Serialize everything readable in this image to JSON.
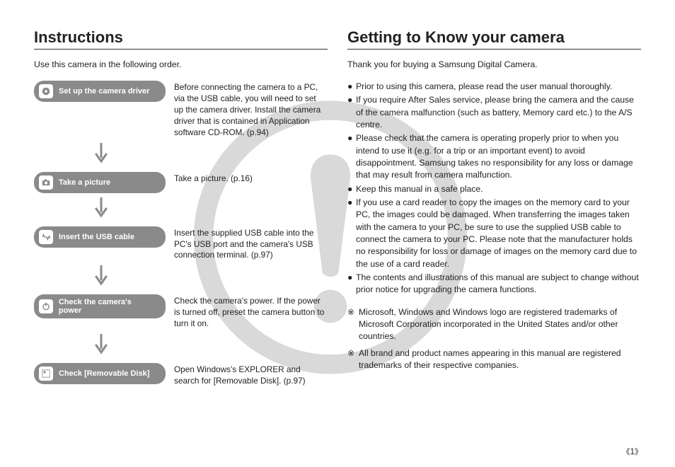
{
  "page_number": "1",
  "left": {
    "title": "Instructions",
    "subtitle": "Use this camera in the following order.",
    "steps": [
      {
        "label": "Set up the camera driver",
        "icon": "cd-icon",
        "text": "Before connecting the camera to a PC, via the USB cable, you will need to set up the camera driver. Install the camera driver that is contained in Application software CD-ROM. (p.94)"
      },
      {
        "label": "Take a picture",
        "icon": "camera-icon",
        "text": "Take a picture. (p.16)"
      },
      {
        "label": "Insert the USB cable",
        "icon": "usb-icon",
        "text": "Insert the supplied USB cable into the PC's USB port and the camera's USB connection terminal. (p.97)"
      },
      {
        "label": "Check the camera's power",
        "icon": "power-icon",
        "text": "Check the camera's power. If the power is turned off, preset the camera button to turn it on."
      },
      {
        "label": "Check [Removable Disk]",
        "icon": "grid-icon",
        "text": "Open Windows's EXPLORER and search for [Removable Disk]. (p.97)"
      }
    ]
  },
  "right": {
    "title": "Getting to Know your camera",
    "thanks": "Thank you for buying a Samsung Digital Camera.",
    "bullets": [
      "Prior to using this camera, please read the user manual thoroughly.",
      "If you require After Sales service, please bring the camera and the cause of the camera malfunction (such as battery, Memory card etc.) to the A/S centre.",
      "Please check that the camera is operating properly prior to when you intend to use it (e.g. for a trip or an important event) to avoid disappointment. Samsung takes no responsibility for any loss or damage that may result from camera malfunction.",
      "Keep this manual in a safe place.",
      "If you use a card reader to copy the images on the memory card to your PC, the images could be damaged. When transferring the images taken with the camera to your PC, be sure to use the supplied USB cable to connect the camera to your PC. Please note that the manufacturer holds no responsibility for loss or damage of images on the memory card due to the use of a card reader.",
      "The contents and illustrations of this manual are subject to change without prior notice for upgrading the camera functions."
    ],
    "trademarks": [
      "Microsoft, Windows and Windows logo are registered trademarks of Microsoft Corporation incorporated in the United States and/or other countries.",
      "All brand and product names appearing in this manual are registered trademarks of their respective companies."
    ]
  }
}
